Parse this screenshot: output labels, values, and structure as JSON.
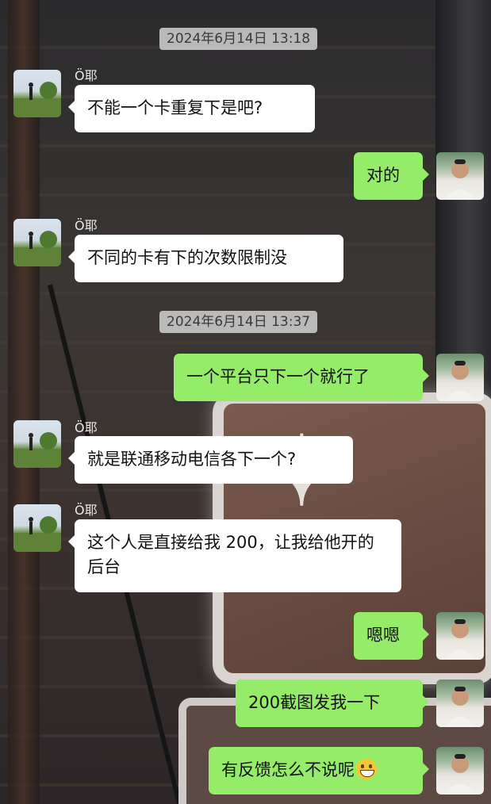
{
  "messages": [
    {
      "type": "timestamp",
      "text": "2024年6月14日 13:18"
    },
    {
      "type": "incoming",
      "sender": "Ö耶",
      "avatar": "contact-avatar-landscape",
      "text": "不能一个卡重复下是吧?"
    },
    {
      "type": "outgoing",
      "avatar": "self-avatar-portrait",
      "text": "对的"
    },
    {
      "type": "incoming",
      "sender": "Ö耶",
      "avatar": "contact-avatar-landscape",
      "text": "不同的卡有下的次数限制没"
    },
    {
      "type": "timestamp",
      "text": "2024年6月14日 13:37"
    },
    {
      "type": "outgoing",
      "avatar": "self-avatar-portrait",
      "text": "一个平台只下一个就行了"
    },
    {
      "type": "incoming",
      "sender": "Ö耶",
      "avatar": "contact-avatar-landscape",
      "text": "就是联通移动电信各下一个?"
    },
    {
      "type": "incoming",
      "sender": "Ö耶",
      "avatar": "contact-avatar-landscape",
      "text": "这个人是直接给我 200，让我给他开的后台"
    },
    {
      "type": "outgoing",
      "avatar": "self-avatar-portrait",
      "text": "嗯嗯"
    },
    {
      "type": "outgoing",
      "avatar": "self-avatar-portrait",
      "text": "200截图发我一下"
    },
    {
      "type": "outgoing",
      "avatar": "self-avatar-portrait",
      "text": "有反馈怎么不说呢",
      "emoji": "grinning-face-emoji"
    }
  ],
  "colors": {
    "incoming_bubble": "#ffffff",
    "outgoing_bubble": "#95ec69",
    "timestamp_bg": "#cdcdcd"
  }
}
